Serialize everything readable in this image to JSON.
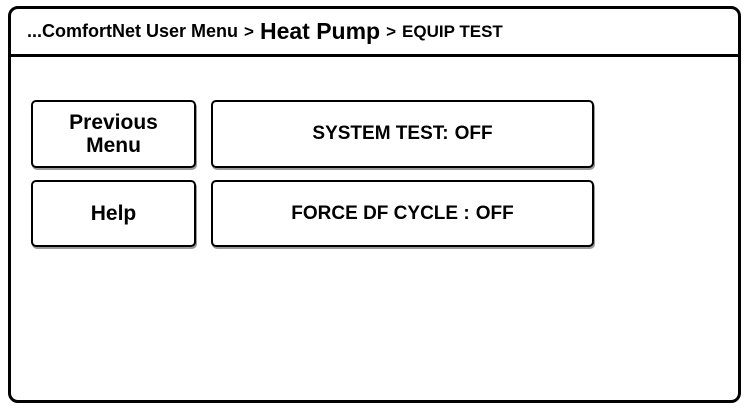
{
  "header": {
    "crumb_root": "...ComfortNet User Menu",
    "sep1": ">",
    "crumb_mid": "Heat Pump",
    "sep2": ">",
    "crumb_end": "EQUIP TEST"
  },
  "menu": {
    "previous_line1": "Previous",
    "previous_line2": "Menu",
    "help": "Help"
  },
  "tests": {
    "system_test_label": "SYSTEM TEST:",
    "system_test_value": "OFF",
    "force_df_label": "FORCE DF CYCLE :",
    "force_df_value": "OFF"
  }
}
